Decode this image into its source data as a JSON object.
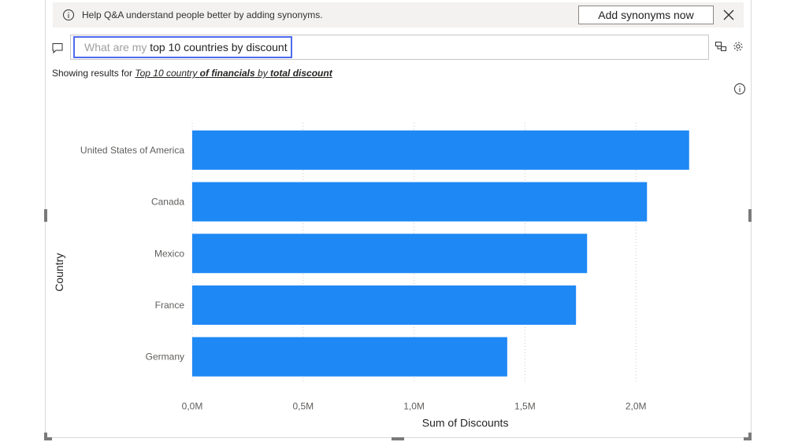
{
  "banner": {
    "message": "Help Q&A understand people better by adding synonyms.",
    "button_label": "Add synonyms now",
    "info_icon": "info-icon",
    "close_icon": "close-icon"
  },
  "qa": {
    "placeholder": "What are my ",
    "query": "top 10 countries by discount",
    "chat_icon": "chat-icon",
    "turn_into_visual_icon": "convert-visual-icon",
    "settings_icon": "gear-icon"
  },
  "results": {
    "prefix": "Showing results for ",
    "part1": "Top 10 country ",
    "part2": "of financials",
    "part3": " by ",
    "part4": "total discount"
  },
  "colors": {
    "bar": "#1e88f5",
    "accent": "#4f6bed"
  },
  "chart_data": {
    "type": "bar",
    "orientation": "horizontal",
    "categories": [
      "United States of America",
      "Canada",
      "Mexico",
      "France",
      "Germany"
    ],
    "values": [
      2240000,
      2050000,
      1780000,
      1730000,
      1420000
    ],
    "xlabel": "Sum of Discounts",
    "ylabel": "Country",
    "xlim": [
      0,
      2500000
    ],
    "xticks": [
      0,
      500000,
      1000000,
      1500000,
      2000000
    ],
    "xtick_labels": [
      "0,0M",
      "0,5M",
      "1,0M",
      "1,5M",
      "2,0M"
    ],
    "grid": "vertical-dotted"
  }
}
